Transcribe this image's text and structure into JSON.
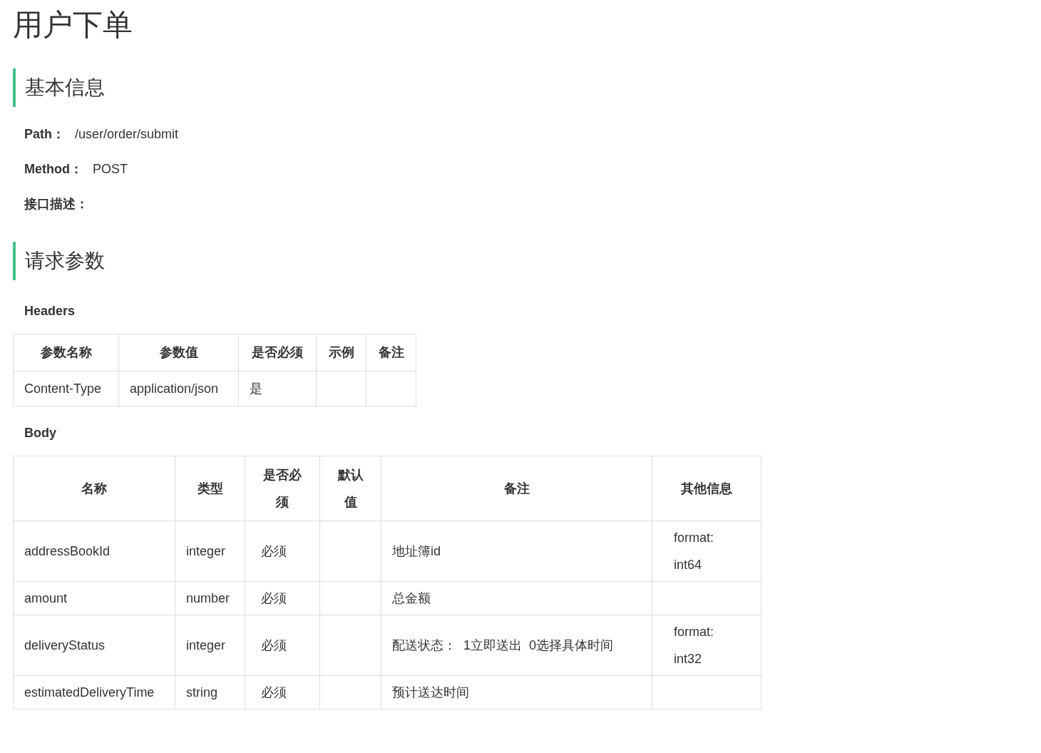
{
  "title": "用户下单",
  "sections": [
    {
      "heading": "基本信息"
    },
    {
      "heading": "请求参数"
    }
  ],
  "basic_info": [
    {
      "label": "Path：",
      "value": "/user/order/submit"
    },
    {
      "label": "Method：",
      "value": "POST"
    },
    {
      "label": "接口描述："
    }
  ],
  "headers_title": "Headers",
  "headers_table": {
    "columns": [
      "参数名称",
      "参数值",
      "是否必须",
      "示例",
      "备注"
    ],
    "rows": [
      [
        "Content-Type",
        "application/json",
        "是",
        "",
        ""
      ]
    ]
  },
  "body_title": "Body",
  "body_table": {
    "columns": [
      "名称",
      "类型",
      "是否必须",
      "默认值",
      "备注",
      "其他信息"
    ],
    "rows": [
      [
        "addressBookId",
        "integer",
        "必须",
        "",
        "地址簿id",
        "format: int64"
      ],
      [
        "amount",
        "number",
        "必须",
        "",
        "总金额",
        ""
      ],
      [
        "deliveryStatus",
        "integer",
        "必须",
        "",
        "配送状态：  1立即送出  0选择具体时间",
        "format: int32"
      ],
      [
        "estimatedDeliveryTime",
        "string",
        "必须",
        "",
        "预计送达时间",
        ""
      ]
    ]
  }
}
